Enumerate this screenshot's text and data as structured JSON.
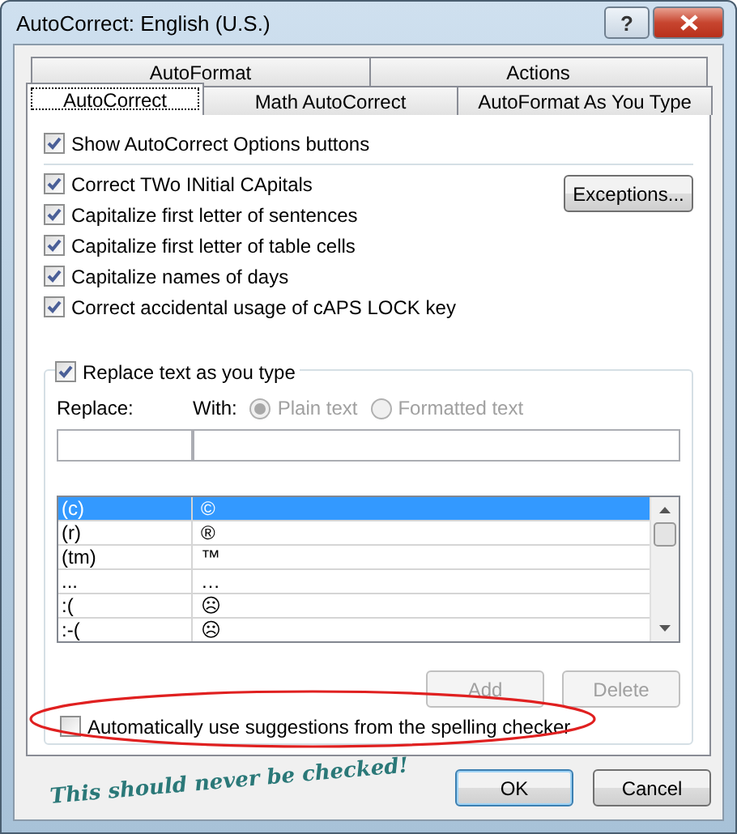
{
  "window": {
    "title": "AutoCorrect: English (U.S.)",
    "help_glyph": "?"
  },
  "tab_rows": [
    [
      {
        "label": "AutoFormat",
        "selected": false
      },
      {
        "label": "Actions",
        "selected": false
      }
    ],
    [
      {
        "label": "AutoCorrect",
        "selected": true
      },
      {
        "label": "Math AutoCorrect",
        "selected": false
      },
      {
        "label": "AutoFormat As You Type",
        "selected": false
      }
    ]
  ],
  "show_options": {
    "label": "Show AutoCorrect Options buttons",
    "checked": true
  },
  "options": [
    {
      "label": "Correct TWo INitial CApitals",
      "checked": true
    },
    {
      "label": "Capitalize first letter of sentences",
      "checked": true
    },
    {
      "label": "Capitalize first letter of table cells",
      "checked": true
    },
    {
      "label": "Capitalize names of days",
      "checked": true
    },
    {
      "label": "Correct accidental usage of cAPS LOCK key",
      "checked": true
    }
  ],
  "exceptions_button": "Exceptions...",
  "replace_group": {
    "checkbox": {
      "label": "Replace text as you type",
      "checked": true
    },
    "replace_label": "Replace:",
    "with_label": "With:",
    "radios": [
      {
        "label": "Plain text",
        "selected": true,
        "disabled": true
      },
      {
        "label": "Formatted text",
        "selected": false,
        "disabled": true
      }
    ],
    "rows": [
      {
        "replace": "(c)",
        "with": "©",
        "selected": true
      },
      {
        "replace": "(r)",
        "with": "®",
        "selected": false
      },
      {
        "replace": "(tm)",
        "with": "™",
        "selected": false
      },
      {
        "replace": "...",
        "with": "…",
        "selected": false
      },
      {
        "replace": ":(",
        "with": "☹",
        "selected": false
      },
      {
        "replace": ":-(",
        "with": "☹",
        "selected": false
      }
    ],
    "buttons": [
      {
        "label": "Add",
        "disabled": true
      },
      {
        "label": "Delete",
        "disabled": true
      }
    ],
    "spelling": {
      "label": "Automatically use suggestions from the spelling checker",
      "checked": false
    }
  },
  "annotation": {
    "note": "This should never be checked!"
  },
  "footer_buttons": [
    {
      "label": "OK",
      "default": true
    },
    {
      "label": "Cancel",
      "default": false
    }
  ]
}
